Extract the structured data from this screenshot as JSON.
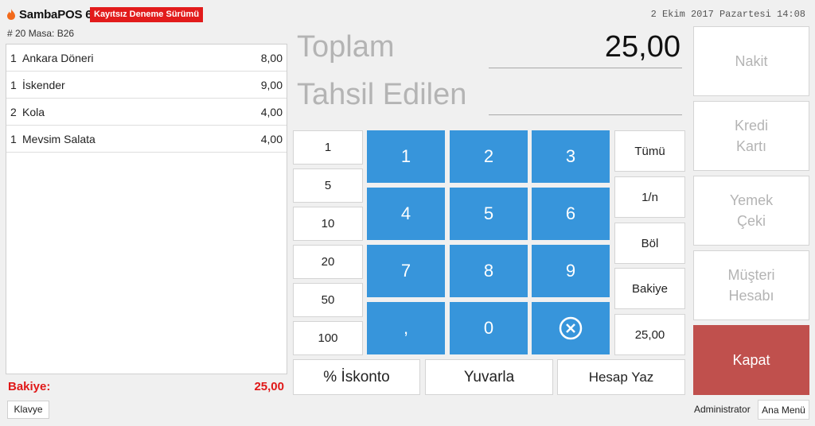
{
  "header": {
    "brand": "SambaPOS 6",
    "trial_badge": "Kayıtsız Deneme Sürümü",
    "datetime": "2 Ekim 2017 Pazartesi 14:08",
    "ticket_info": "# 20 Masa: B26"
  },
  "orders": [
    {
      "qty": "1",
      "name": "Ankara Döneri",
      "price": "8,00"
    },
    {
      "qty": "1",
      "name": "İskender",
      "price": "9,00"
    },
    {
      "qty": "2",
      "name": "Kola",
      "price": "4,00"
    },
    {
      "qty": "1",
      "name": "Mevsim Salata",
      "price": "4,00"
    }
  ],
  "balance": {
    "label": "Bakiye:",
    "value": "25,00"
  },
  "keyboard_label": "Klavye",
  "totals": {
    "total_label": "Toplam",
    "total_value": "25,00",
    "collected_label": "Tahsil Edilen",
    "collected_value": ""
  },
  "amount_buttons": [
    "1",
    "5",
    "10",
    "20",
    "50",
    "100"
  ],
  "keypad": [
    "1",
    "2",
    "3",
    "4",
    "5",
    "6",
    "7",
    "8",
    "9",
    ",",
    "0"
  ],
  "side_buttons": [
    "Tümü",
    "1/n",
    "Böl",
    "Bakiye",
    "25,00"
  ],
  "bottom_buttons": {
    "discount": "% İskonto",
    "round": "Yuvarla",
    "print_bill": "Hesap Yaz"
  },
  "payment_buttons": {
    "cash": "Nakit",
    "credit_card": "Kredi\nKartı",
    "meal_voucher": "Yemek\nÇeki",
    "customer_account": "Müşteri\nHesabı",
    "close": "Kapat"
  },
  "footer": {
    "user": "Administrator",
    "main_menu": "Ana Menü"
  },
  "colors": {
    "keypad": "#3795db",
    "close": "#c0504d",
    "trial": "#e21b1b",
    "balance": "#e01818"
  },
  "icons": {
    "logo": "flame-icon",
    "clear": "circle-x-icon"
  }
}
